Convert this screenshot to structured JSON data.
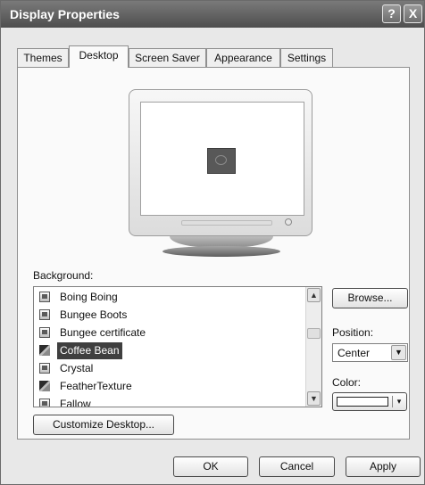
{
  "window": {
    "title": "Display Properties",
    "help_label": "?",
    "close_label": "X"
  },
  "tabs": [
    "Themes",
    "Desktop",
    "Screen Saver",
    "Appearance",
    "Settings"
  ],
  "active_tab": "Desktop",
  "background_label": "Background:",
  "background_list": {
    "items": [
      {
        "label": "Boing Boing",
        "icon": "image-file-icon"
      },
      {
        "label": "Bungee Boots",
        "icon": "image-file-icon"
      },
      {
        "label": "Bungee certificate",
        "icon": "image-file-icon"
      },
      {
        "label": "Coffee Bean",
        "icon": "wallpaper-image-icon",
        "selected": true
      },
      {
        "label": "Crystal",
        "icon": "image-file-icon"
      },
      {
        "label": "FeatherTexture",
        "icon": "wallpaper-image-icon"
      },
      {
        "label": "Fallow",
        "icon": "image-file-icon"
      }
    ],
    "scroll_up": "▲",
    "scroll_down": "▼"
  },
  "browse_label": "Browse...",
  "position_label": "Position:",
  "position_value": "Center",
  "select_arrow": "▼",
  "color_label": "Color:",
  "color_value": "#ffffff",
  "color_arrow": "▾",
  "customize_label": "Customize Desktop...",
  "buttons": {
    "ok": "OK",
    "cancel": "Cancel",
    "apply": "Apply"
  },
  "colors": {
    "titlebar": "#5a5a5a",
    "selection": "#3f3f3f"
  }
}
